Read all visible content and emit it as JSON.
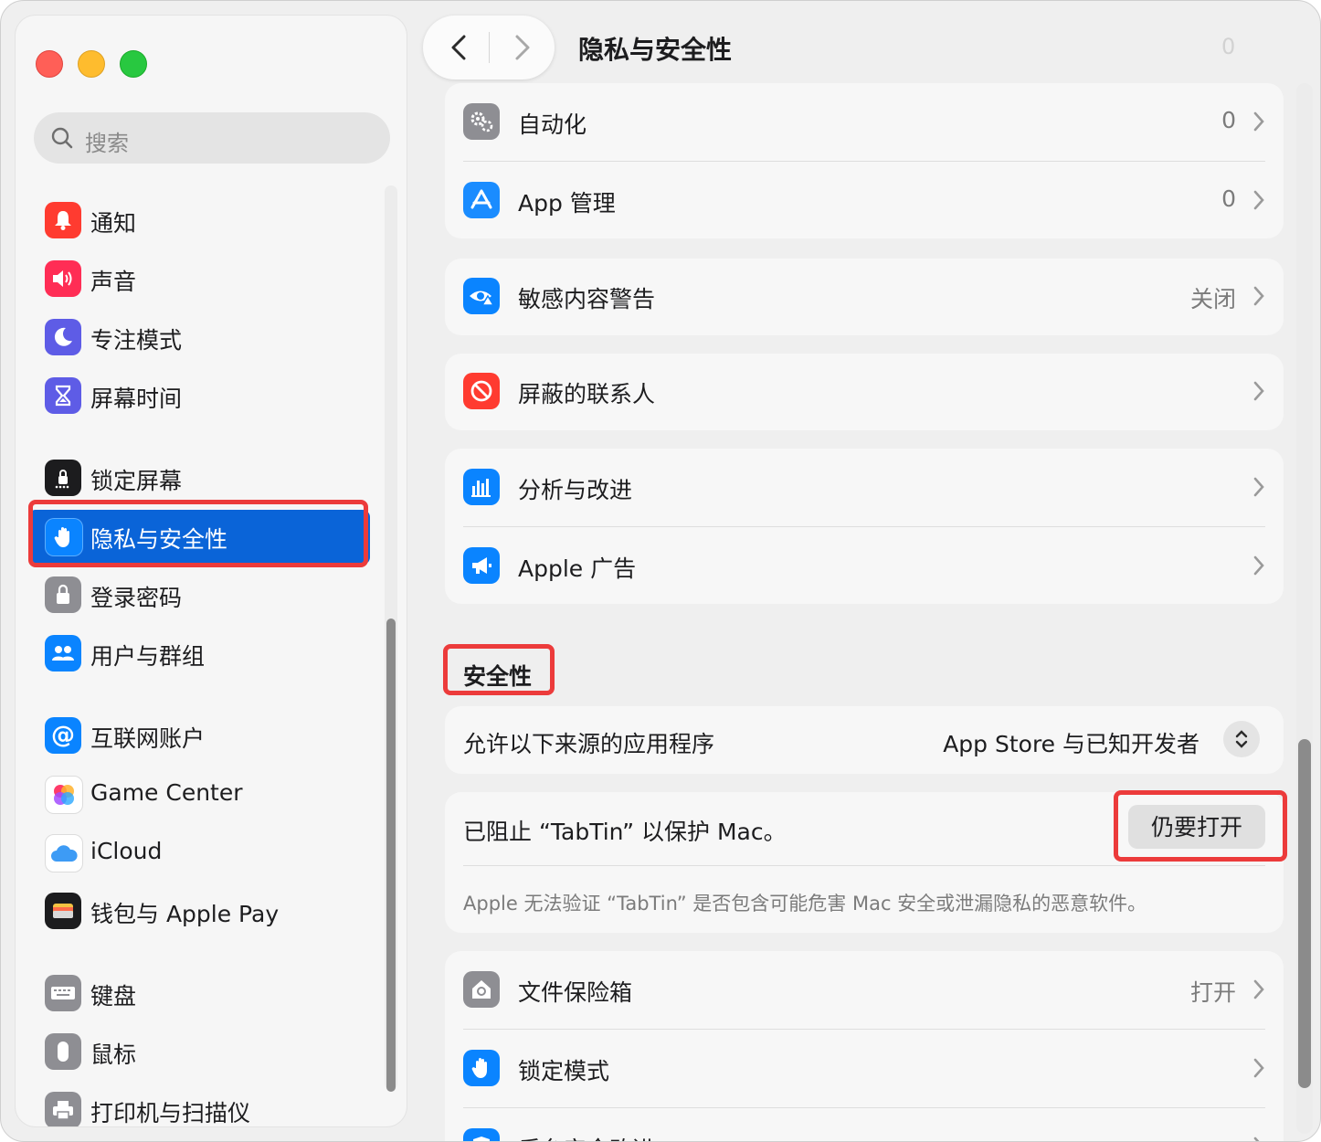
{
  "window": {
    "page_title": "隐私与安全性",
    "title_ghost_value": "0"
  },
  "sidebar": {
    "search_placeholder": "搜索",
    "items": [
      {
        "label": "通知",
        "icon": "bell-icon",
        "color": "#ff3b30",
        "selected": false
      },
      {
        "label": "声音",
        "icon": "speaker-icon",
        "color": "#ff2d55",
        "selected": false
      },
      {
        "label": "专注模式",
        "icon": "moon-icon",
        "color": "#5e5ce6",
        "selected": false
      },
      {
        "label": "屏幕时间",
        "icon": "hourglass-icon",
        "color": "#5e5ce6",
        "selected": false
      },
      {
        "label": "锁定屏幕",
        "icon": "lock-screen-icon",
        "color": "#1c1c1e",
        "selected": false
      },
      {
        "label": "隐私与安全性",
        "icon": "hand-icon",
        "color": "#0a84ff",
        "selected": true
      },
      {
        "label": "登录密码",
        "icon": "lock-icon",
        "color": "#8e8e93",
        "selected": false
      },
      {
        "label": "用户与群组",
        "icon": "users-icon",
        "color": "#0a84ff",
        "selected": false
      },
      {
        "label": "互联网账户",
        "icon": "at-icon",
        "color": "#0a84ff",
        "selected": false
      },
      {
        "label": "Game Center",
        "icon": "game-center-icon",
        "color": "#ffffff",
        "selected": false
      },
      {
        "label": "iCloud",
        "icon": "cloud-icon",
        "color": "#ffffff",
        "selected": false
      },
      {
        "label": "钱包与 Apple Pay",
        "icon": "wallet-icon",
        "color": "#1c1c1e",
        "selected": false
      },
      {
        "label": "键盘",
        "icon": "keyboard-icon",
        "color": "#8e8e93",
        "selected": false
      },
      {
        "label": "鼠标",
        "icon": "mouse-icon",
        "color": "#8e8e93",
        "selected": false
      },
      {
        "label": "打印机与扫描仪",
        "icon": "printer-icon",
        "color": "#8e8e93",
        "selected": false
      }
    ]
  },
  "privacy": {
    "automation": {
      "label": "自动化",
      "value": "0",
      "icon": "gears-icon"
    },
    "app_management": {
      "label": "App 管理",
      "value": "0",
      "icon": "app-store-icon"
    },
    "sensitive_content": {
      "label": "敏感内容警告",
      "value": "关闭",
      "icon": "eye-warning-icon"
    },
    "blocked_contacts": {
      "label": "屏蔽的联系人",
      "icon": "blocked-icon"
    },
    "analytics": {
      "label": "分析与改进",
      "icon": "chart-icon"
    },
    "apple_ads": {
      "label": "Apple 广告",
      "icon": "megaphone-icon"
    }
  },
  "security": {
    "section_title": "安全性",
    "allow_label": "允许以下来源的应用程序",
    "allow_value": "App Store 与已知开发者",
    "blocked_message": "已阻止 “TabTin” 以保护 Mac。",
    "open_anyway": "仍要打开",
    "description": "Apple 无法验证 “TabTin” 是否包含可能危害 Mac 安全或泄漏隐私的恶意软件。",
    "filevault": {
      "label": "文件保险箱",
      "value": "打开",
      "icon": "filevault-icon"
    },
    "lockdown": {
      "label": "锁定模式",
      "icon": "hand-icon"
    },
    "background_security": {
      "label": "后台安全改进",
      "icon": "shield-icon"
    }
  },
  "colors": {
    "accent": "#0a64d8",
    "highlight": "#ec3b3b"
  }
}
